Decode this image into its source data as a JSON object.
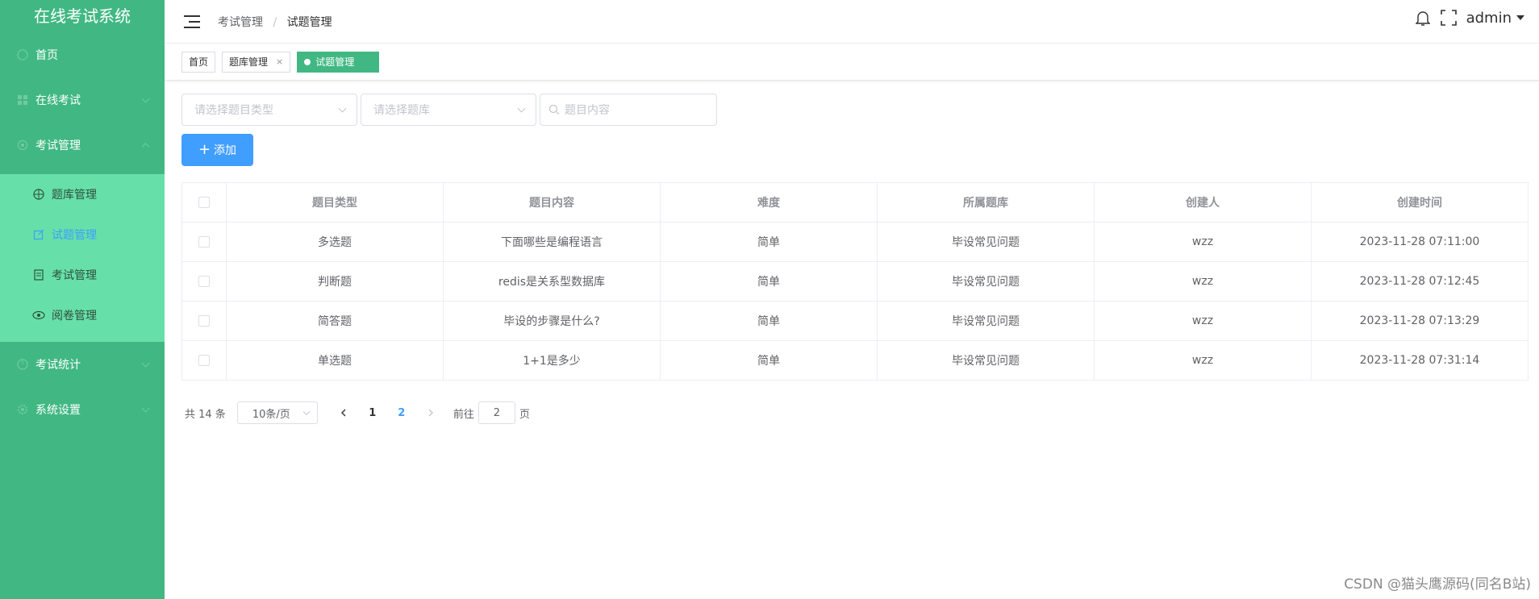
{
  "app": {
    "title": "在线考试系统"
  },
  "sidebar": {
    "items": [
      {
        "label": "首页",
        "icon": "home-icon"
      },
      {
        "label": "在线考试",
        "icon": "grid-icon"
      },
      {
        "label": "考试管理",
        "icon": "settings-icon"
      }
    ],
    "subitems": [
      {
        "label": "题库管理",
        "icon": "target-icon"
      },
      {
        "label": "试题管理",
        "icon": "edit-icon",
        "active": true
      },
      {
        "label": "考试管理",
        "icon": "document-icon"
      },
      {
        "label": "阅卷管理",
        "icon": "eye-icon"
      }
    ],
    "items_after": [
      {
        "label": "考试统计",
        "icon": "chart-icon"
      },
      {
        "label": "系统设置",
        "icon": "gear-icon"
      }
    ]
  },
  "header": {
    "breadcrumb": [
      "考试管理",
      "试题管理"
    ],
    "separator": "/",
    "username": "admin"
  },
  "tags": [
    {
      "label": "首页"
    },
    {
      "label": "题库管理",
      "close": "×"
    },
    {
      "label": "试题管理",
      "active": true
    }
  ],
  "filters": {
    "type_placeholder": "请选择题目类型",
    "bank_placeholder": "请选择题库",
    "content_placeholder": "题目内容"
  },
  "toolbar": {
    "add_label": "添加"
  },
  "table": {
    "headers": [
      "题目类型",
      "题目内容",
      "难度",
      "所属题库",
      "创建人",
      "创建时间"
    ],
    "rows": [
      [
        "多选题",
        "下面哪些是编程语言",
        "简单",
        "毕设常见问题",
        "wzz",
        "2023-11-28 07:11:00"
      ],
      [
        "判断题",
        "redis是关系型数据库",
        "简单",
        "毕设常见问题",
        "wzz",
        "2023-11-28 07:12:45"
      ],
      [
        "简答题",
        "毕设的步骤是什么?",
        "简单",
        "毕设常见问题",
        "wzz",
        "2023-11-28 07:13:29"
      ],
      [
        "单选题",
        "1+1是多少",
        "简单",
        "毕设常见问题",
        "wzz",
        "2023-11-28 07:31:14"
      ]
    ]
  },
  "pagination": {
    "total_text": "共 14 条",
    "page_size": "10条/页",
    "pages": [
      "1",
      "2"
    ],
    "current_page": "2",
    "goto_label": "前往",
    "goto_value": "2",
    "goto_suffix": "页"
  },
  "watermark": "CSDN @猫头鹰源码(同名B站)",
  "colors": {
    "sidebar": "#41b883",
    "submenu": "#66e0a8",
    "primary": "#409eff"
  }
}
